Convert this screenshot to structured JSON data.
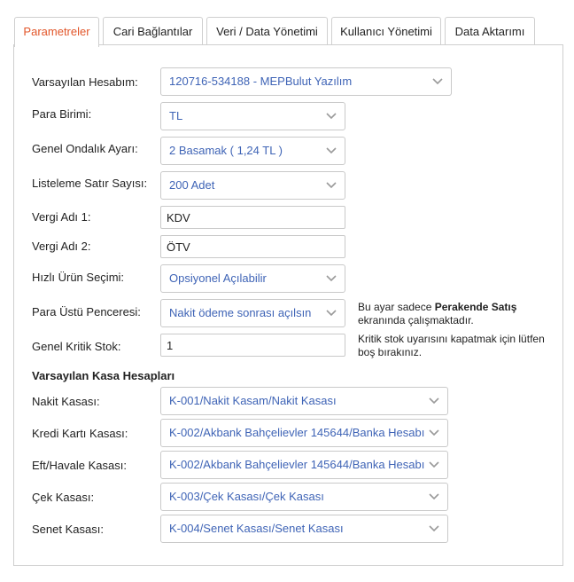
{
  "tabs": [
    {
      "label": "Parametreler",
      "active": true
    },
    {
      "label": "Cari Bağlantılar"
    },
    {
      "label": "Veri / Data Yönetimi"
    },
    {
      "label": "Kullanıcı Yönetimi"
    },
    {
      "label": "Data Aktarımı"
    }
  ],
  "form": {
    "account_label": "Varsayılan Hesabım:",
    "account_value": "120716-534188 - MEPBulut Yazılım",
    "currency_label": "Para Birimi:",
    "currency_value": "TL",
    "decimal_label": "Genel Ondalık Ayarı:",
    "decimal_value": "2 Basamak ( 1,24 TL )",
    "rows_label": "Listeleme Satır Sayısı:",
    "rows_value": "200 Adet",
    "tax1_label": "Vergi Adı 1:",
    "tax1_value": "KDV",
    "tax2_label": "Vergi Adı 2:",
    "tax2_value": "ÖTV",
    "quick_product_label": "Hızlı Ürün Seçimi:",
    "quick_product_value": "Opsiyonel Açılabilir",
    "change_window_label": "Para Üstü Penceresi:",
    "change_window_value": "Nakit ödeme sonrası açılsın",
    "change_window_note_pre": "Bu ayar sadece ",
    "change_window_note_bold": "Perakende Satış",
    "change_window_note_post": " ekranında çalışmaktadır.",
    "critical_stock_label": "Genel Kritik Stok:",
    "critical_stock_value": "1",
    "critical_stock_note": "Kritik stok uyarısını kapatmak için lütfen boş bırakınız."
  },
  "cash": {
    "section_title": "Varsayılan Kasa Hesapları",
    "cash_label": "Nakit Kasası:",
    "cash_value": "K-001/Nakit Kasam/Nakit Kasası",
    "credit_label": "Kredi Kartı Kasası:",
    "credit_value": "K-002/Akbank Bahçelievler 145644/Banka Hesabı",
    "eft_label": "Eft/Havale Kasası:",
    "eft_value": "K-002/Akbank Bahçelievler 145644/Banka Hesabı",
    "check_label": "Çek Kasası:",
    "check_value": "K-003/Çek Kasası/Çek Kasası",
    "note_label": "Senet Kasası:",
    "note_value": "K-004/Senet Kasası/Senet Kasası"
  },
  "icons": {
    "dropdown": "chevron-down-icon"
  },
  "colors": {
    "active_tab": "#e2572b",
    "select_text": "#3f64b6",
    "border": "#cfcfcf"
  }
}
